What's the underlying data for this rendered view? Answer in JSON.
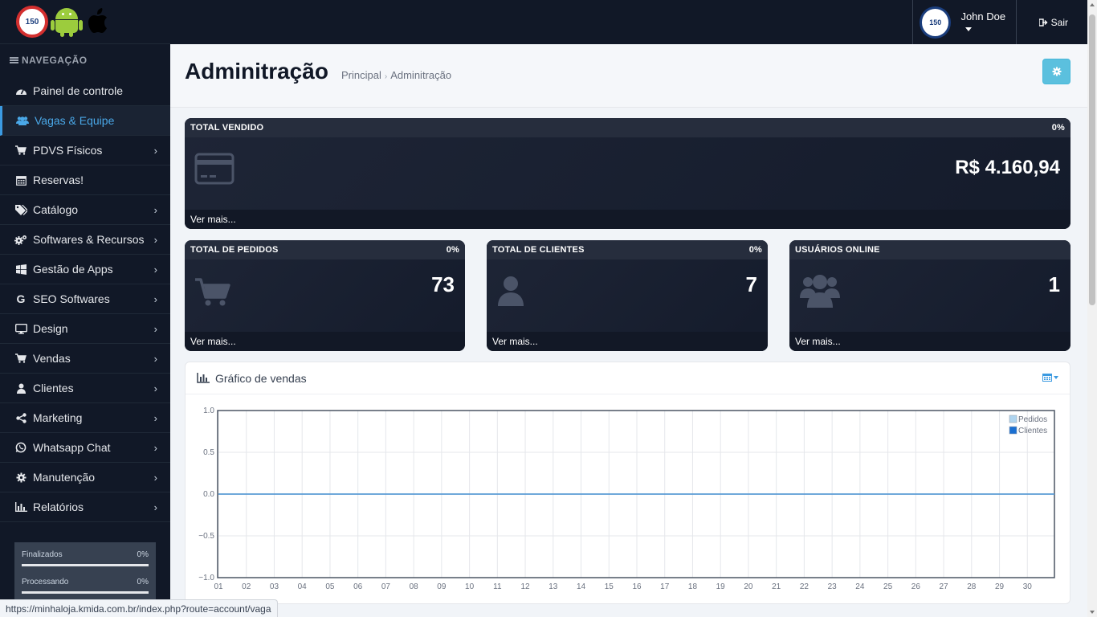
{
  "brand": {
    "logo_text": "150"
  },
  "nav": {
    "header": "NAVEGAÇÃO",
    "items": [
      {
        "label": "Painel de controle",
        "icon": "dashboard-icon",
        "chevron": false
      },
      {
        "label": "Vagas & Equipe",
        "icon": "users-icon",
        "chevron": false,
        "active": true
      },
      {
        "label": "PDVS Físicos",
        "icon": "cart-icon",
        "chevron": true
      },
      {
        "label": "Reservas!",
        "icon": "calendar-icon",
        "chevron": false
      },
      {
        "label": "Catálogo",
        "icon": "tags-icon",
        "chevron": true
      },
      {
        "label": "Softwares & Recursos",
        "icon": "cogs-icon",
        "chevron": true
      },
      {
        "label": "Gestão de Apps",
        "icon": "windows-icon",
        "chevron": true
      },
      {
        "label": "SEO Softwares",
        "icon": "google-icon",
        "chevron": true
      },
      {
        "label": "Design",
        "icon": "desktop-icon",
        "chevron": true
      },
      {
        "label": "Vendas",
        "icon": "cart-icon",
        "chevron": true
      },
      {
        "label": "Clientes",
        "icon": "user-icon",
        "chevron": true
      },
      {
        "label": "Marketing",
        "icon": "share-icon",
        "chevron": true
      },
      {
        "label": "Whatsapp Chat",
        "icon": "whatsapp-icon",
        "chevron": true
      },
      {
        "label": "Manutenção",
        "icon": "gear-icon",
        "chevron": true
      },
      {
        "label": "Relatórios",
        "icon": "bar-chart-icon",
        "chevron": true
      }
    ]
  },
  "progress": [
    {
      "label": "Finalizados",
      "value": "0%",
      "fraction": 0
    },
    {
      "label": "Processando",
      "value": "0%",
      "fraction": 0
    }
  ],
  "topbar": {
    "user_name": "John Doe",
    "avatar_text": "150",
    "logout_label": "Sair"
  },
  "page": {
    "title": "Adminitração",
    "breadcrumb": [
      "Principal",
      "Adminitração"
    ]
  },
  "tiles": {
    "total_sold": {
      "title": "TOTAL VENDIDO",
      "percent": "0%",
      "value": "R$ 4.160,94",
      "more": "Ver mais..."
    },
    "orders": {
      "title": "TOTAL DE PEDIDOS",
      "percent": "0%",
      "value": "73",
      "more": "Ver mais..."
    },
    "clients": {
      "title": "TOTAL DE CLIENTES",
      "percent": "0%",
      "value": "7",
      "more": "Ver mais..."
    },
    "online": {
      "title": "USUÁRIOS ONLINE",
      "value": "1",
      "more": "Ver mais..."
    }
  },
  "chart_card": {
    "title": "Gráfico de vendas"
  },
  "chart_data": {
    "type": "line",
    "x": [
      "01",
      "02",
      "03",
      "04",
      "05",
      "06",
      "07",
      "08",
      "09",
      "10",
      "11",
      "12",
      "13",
      "14",
      "15",
      "16",
      "17",
      "18",
      "19",
      "20",
      "21",
      "22",
      "23",
      "24",
      "25",
      "26",
      "27",
      "28",
      "29",
      "30"
    ],
    "y_ticks": [
      "1.0",
      "0.5",
      "0.0",
      "−0.5",
      "−1.0"
    ],
    "ylim": [
      -1,
      1
    ],
    "series": [
      {
        "name": "Pedidos",
        "color": "#aed4ef",
        "values": [
          0,
          0,
          0,
          0,
          0,
          0,
          0,
          0,
          0,
          0,
          0,
          0,
          0,
          0,
          0,
          0,
          0,
          0,
          0,
          0,
          0,
          0,
          0,
          0,
          0,
          0,
          0,
          0,
          0,
          0
        ]
      },
      {
        "name": "Clientes",
        "color": "#1a6fd1",
        "values": [
          0,
          0,
          0,
          0,
          0,
          0,
          0,
          0,
          0,
          0,
          0,
          0,
          0,
          0,
          0,
          0,
          0,
          0,
          0,
          0,
          0,
          0,
          0,
          0,
          0,
          0,
          0,
          0,
          0,
          0
        ]
      }
    ],
    "legend": "top-right",
    "grid": true
  },
  "statusbar": {
    "url": "https://minhaloja.kmida.com.br/index.php?route=account/vaga"
  }
}
